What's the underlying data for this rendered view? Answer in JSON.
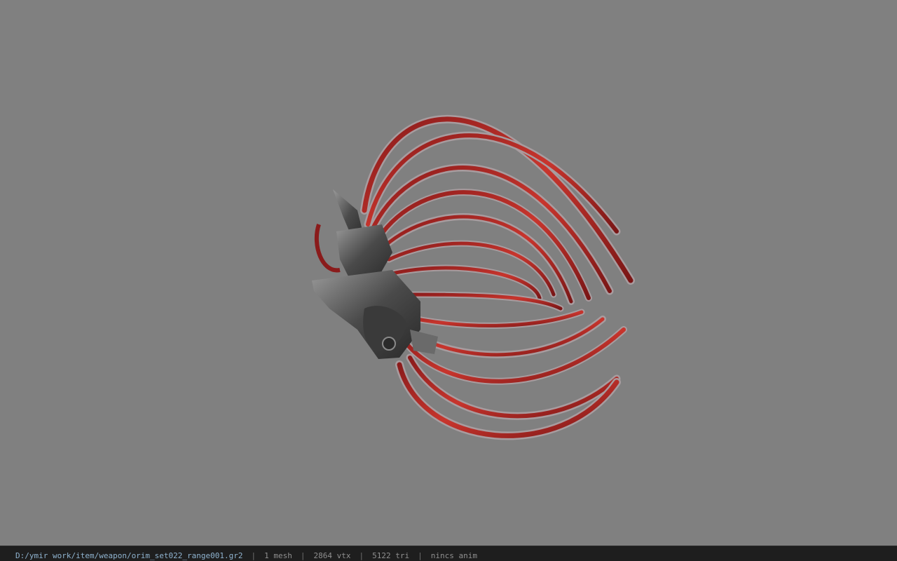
{
  "viewer": {
    "file_path": "D:/ymir work/item/weapon/orim_set022_range001.gr2",
    "mesh_count": "1 mesh",
    "vertex_count": "2864 vtx",
    "triangle_count": "5122 tri",
    "anim_status": "nincs anim",
    "separator": "|"
  },
  "colors": {
    "background": "#808080",
    "statusbar": "#1e1e1e",
    "blade_red": "#b42b2b",
    "blade_edge": "#a89c9f",
    "hilt_metal": "#5c5c5c"
  },
  "model": {
    "name_icon": "bow-model-3d"
  }
}
